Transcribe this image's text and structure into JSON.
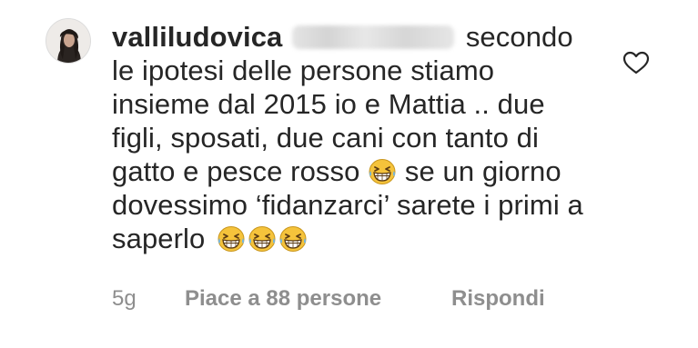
{
  "comment": {
    "username": "valliludovica",
    "text_line1": "secondo",
    "text_rest": "le ipotesi delle persone stiamo insieme dal 2015 io e Mattia .. due figli, sposati, due cani con tanto di gatto e pesce rosso",
    "text_after_emoji": "se un giorno dovessimo ‘fidanzarci’ sarete i primi a saperlo",
    "emoji_name": "grinning-squinting-face",
    "trailing_emoji_count": 3,
    "avatar_icon": "profile-photo-avatar",
    "like_icon": "heart-outline-icon"
  },
  "meta": {
    "time": "5g",
    "likes": "Piace a 88 persone",
    "reply": "Rispondi"
  },
  "colors": {
    "text": "#262626",
    "secondary": "#8e8e8e",
    "emoji_face": "#f5c33b"
  }
}
